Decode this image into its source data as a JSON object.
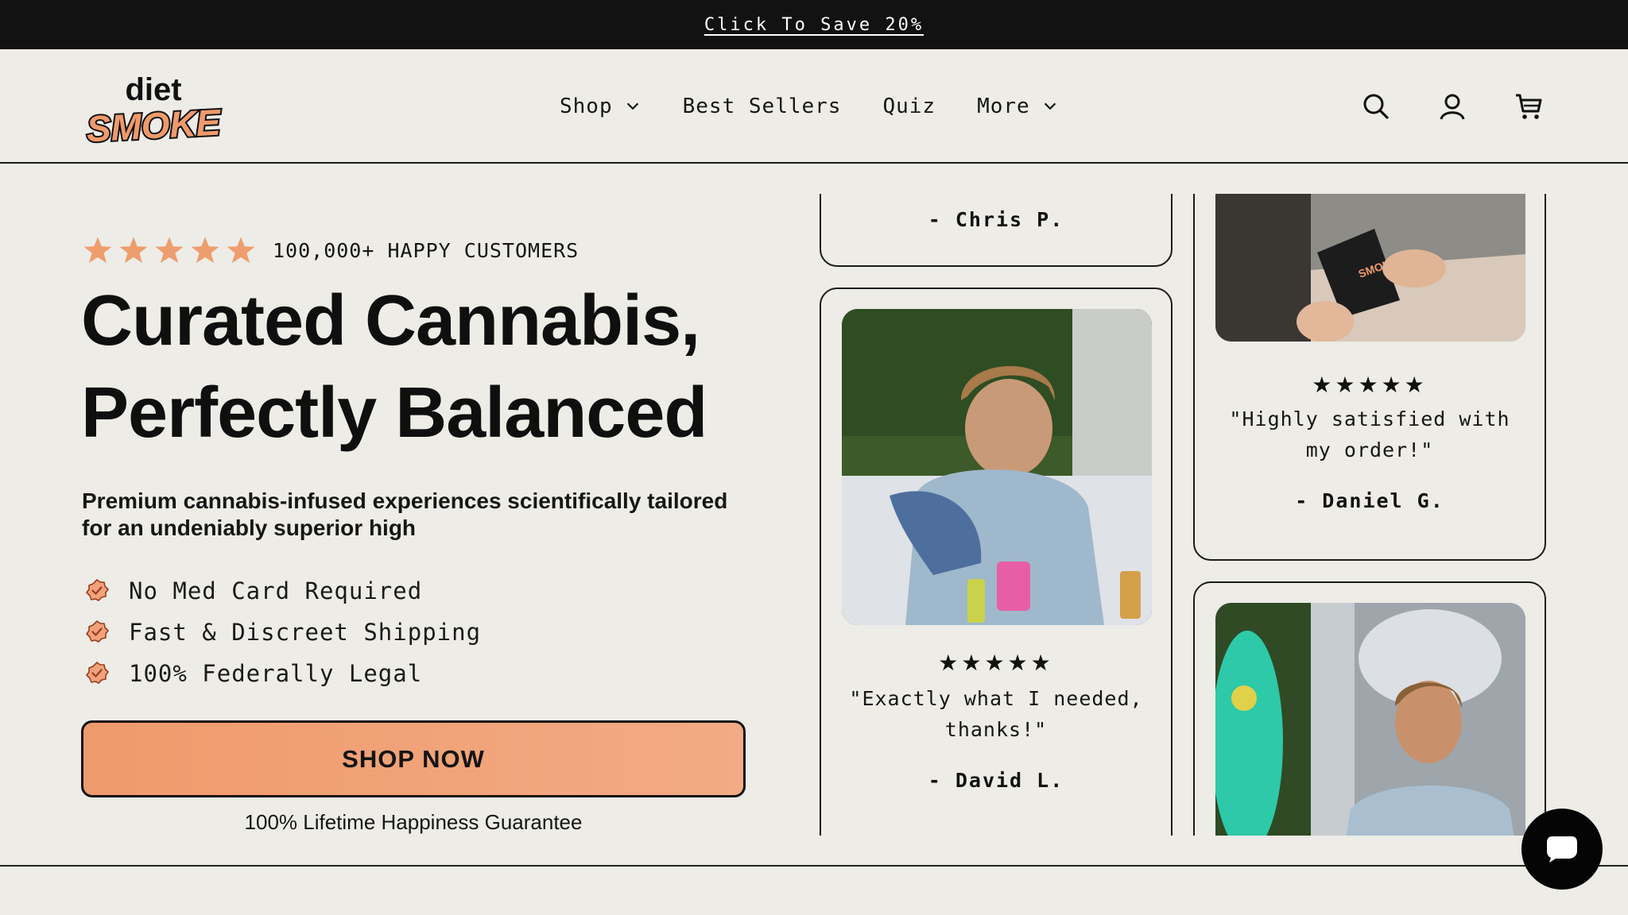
{
  "announcement": {
    "text": "Click To Save 20%"
  },
  "header": {
    "logo": {
      "top": "diet",
      "bottom": "SMOKE"
    },
    "nav": [
      {
        "label": "Shop",
        "has_dropdown": true
      },
      {
        "label": "Best Sellers",
        "has_dropdown": false
      },
      {
        "label": "Quiz",
        "has_dropdown": false
      },
      {
        "label": "More",
        "has_dropdown": true
      }
    ],
    "icons": [
      "search-icon",
      "account-icon",
      "cart-icon"
    ]
  },
  "hero": {
    "rating": {
      "stars": 5,
      "text": "100,000+ HAPPY CUSTOMERS"
    },
    "headline_line1": "Curated Cannabis,",
    "headline_line2": "Perfectly Balanced",
    "subheadline": "Premium cannabis-infused experiences scientifically tailored for an undeniably superior high",
    "features": [
      "No Med Card Required",
      "Fast & Discreet Shipping",
      "100% Federally Legal"
    ],
    "cta": "SHOP NOW",
    "guarantee": "100% Lifetime Happiness Guarantee"
  },
  "reviews": [
    {
      "author": "- Chris P."
    },
    {
      "stars": "★★★★★",
      "quote": "\"Exactly what I needed, thanks!\"",
      "author": "- David L."
    },
    {
      "stars": "★★★★★",
      "quote": "\"Highly satisfied with my order!\"",
      "author": "- Daniel G."
    }
  ],
  "colors": {
    "accent": "#ef9a6c",
    "star": "#ee9d6e",
    "background": "#edece6",
    "dark": "#121212"
  }
}
